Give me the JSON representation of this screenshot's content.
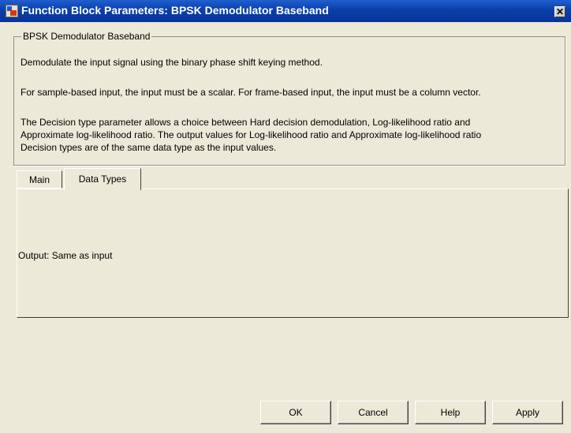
{
  "window": {
    "title": "Function Block Parameters: BPSK Demodulator Baseband"
  },
  "group": {
    "title": "BPSK Demodulator Baseband",
    "paragraphs": [
      "Demodulate the input signal using the binary phase shift keying method.",
      "For sample-based input, the input must be a scalar. For frame-based input, the input must be a column vector.",
      "The Decision type parameter allows a choice between Hard decision demodulation, Log-likelihood ratio and",
      "Approximate log-likelihood ratio.  The output values for Log-likelihood ratio and Approximate log-likelihood ratio",
      "Decision types are of the same data type as the input values."
    ]
  },
  "tabs": [
    {
      "label": "Main",
      "active": false
    },
    {
      "label": "Data Types",
      "active": true
    }
  ],
  "panel": {
    "output_text": "Output: Same as input"
  },
  "buttons": {
    "ok": "OK",
    "cancel": "Cancel",
    "help": "Help",
    "apply": "Apply"
  },
  "icons": {
    "window": "simulink-block-icon",
    "close": "close-icon"
  },
  "colors": {
    "titlebar": "#0a3fa8",
    "background": "#ece9d8"
  }
}
